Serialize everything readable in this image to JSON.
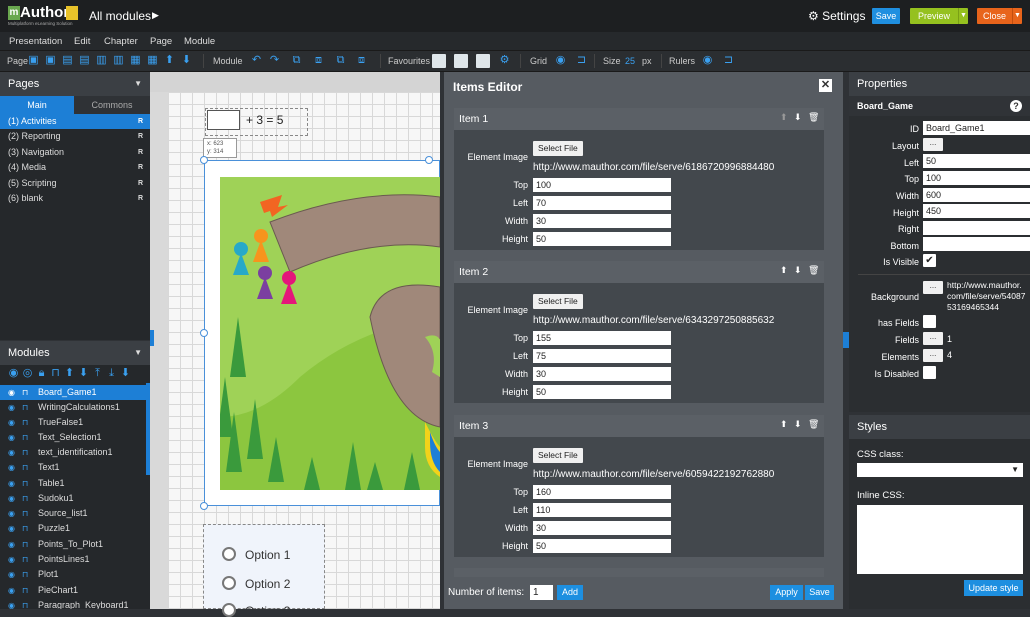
{
  "app": {
    "logo_text": "Author",
    "logo_m": "m",
    "logo_tagline": "Multiplatform eLearning Solution",
    "title": "All modules",
    "settings": "Settings",
    "save": "Save",
    "preview": "Preview",
    "close": "Close"
  },
  "menu": [
    "Presentation",
    "Edit",
    "Chapter",
    "Page",
    "Module"
  ],
  "toolbar": {
    "page": "Page",
    "module": "Module",
    "favourites": "Favourites",
    "grid": "Grid",
    "size": "Size",
    "size_value": "25",
    "size_unit": "px",
    "rulers": "Rulers"
  },
  "pages_panel": {
    "title": "Pages",
    "tabs": [
      "Main",
      "Commons"
    ],
    "items": [
      {
        "label": "(1) Activities",
        "flag": "R",
        "selected": true
      },
      {
        "label": "(2) Reporting",
        "flag": "R"
      },
      {
        "label": "(3) Navigation",
        "flag": "R"
      },
      {
        "label": "(4) Media",
        "flag": "R"
      },
      {
        "label": "(5) Scripting",
        "flag": "R"
      },
      {
        "label": "(6) blank",
        "flag": "R"
      }
    ]
  },
  "modules_panel": {
    "title": "Modules",
    "items": [
      {
        "label": "Board_Game1",
        "selected": true
      },
      {
        "label": "WritingCalculations1"
      },
      {
        "label": "TrueFalse1"
      },
      {
        "label": "Text_Selection1"
      },
      {
        "label": "text_identification1"
      },
      {
        "label": "Text1"
      },
      {
        "label": "Table1"
      },
      {
        "label": "Sudoku1"
      },
      {
        "label": "Source_list1"
      },
      {
        "label": "Puzzle1"
      },
      {
        "label": "Points_To_Plot1"
      },
      {
        "label": "PointsLines1"
      },
      {
        "label": "Plot1"
      },
      {
        "label": "PieChart1"
      },
      {
        "label": "Paragraph_Keyboard1"
      }
    ]
  },
  "canvas": {
    "equation": "+ 3 = 5",
    "coord_x": "x: 623",
    "coord_y": "y: 314",
    "options": [
      "Option 1",
      "Option 2",
      "Option 3"
    ]
  },
  "items_editor": {
    "title": "Items Editor",
    "element_image_label": "Element Image",
    "select_file": "Select File",
    "labels": {
      "top": "Top",
      "left": "Left",
      "width": "Width",
      "height": "Height"
    },
    "items": [
      {
        "title": "Item 1",
        "url": "http://www.mauthor.com/file/serve/6186720996884480",
        "top": "100",
        "left": "70",
        "width": "30",
        "height": "50"
      },
      {
        "title": "Item 2",
        "url": "http://www.mauthor.com/file/serve/6343297250885632",
        "top": "155",
        "left": "75",
        "width": "30",
        "height": "50"
      },
      {
        "title": "Item 3",
        "url": "http://www.mauthor.com/file/serve/6059422192762880",
        "top": "160",
        "left": "110",
        "width": "30",
        "height": "50"
      }
    ],
    "number_of_items_label": "Number of items:",
    "number_of_items": "1",
    "add": "Add",
    "apply": "Apply",
    "save": "Save"
  },
  "properties": {
    "title": "Properties",
    "module_name": "Board_Game",
    "id_label": "ID",
    "id": "Board_Game1",
    "layout_label": "Layout",
    "left_label": "Left",
    "left": "50",
    "top_label": "Top",
    "top": "100",
    "width_label": "Width",
    "width": "600",
    "height_label": "Height",
    "height": "450",
    "right_label": "Right",
    "right": "",
    "bottom_label": "Bottom",
    "bottom": "",
    "is_visible_label": "Is Visible",
    "is_visible": true,
    "background_label": "Background",
    "background_url": "http://www.mauthor.com/file/serve/5408753169465344",
    "background_url_lines": [
      "http://www.mauthor.",
      "com/file/serve/54087",
      "53169465344"
    ],
    "has_fields_label": "has Fields",
    "fields_label": "Fields",
    "fields": "1",
    "elements_label": "Elements",
    "elements": "4",
    "is_disabled_label": "Is Disabled",
    "btn_dots": "..."
  },
  "styles": {
    "title": "Styles",
    "css_class_label": "CSS class:",
    "inline_css_label": "Inline CSS:",
    "update_button": "Update style"
  },
  "colors": {
    "accent": "#1d7fd6",
    "preview": "#95c11f",
    "close": "#e8641b",
    "board_green": "#8cc63f",
    "path_brown": "#a0887a"
  }
}
